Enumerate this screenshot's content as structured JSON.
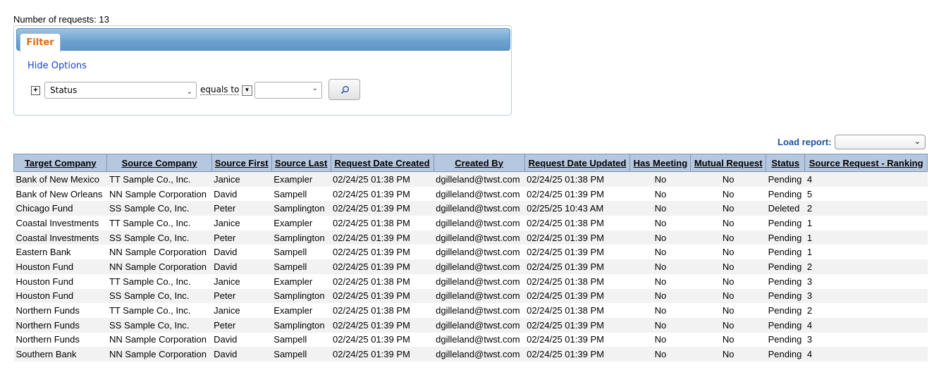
{
  "summary": {
    "label": "Number of requests: 13"
  },
  "filter": {
    "tab_label": "Filter",
    "hide_options_label": "Hide Options",
    "field_value": "Status",
    "operator_label": "equals to",
    "value": ""
  },
  "report": {
    "load_label": "Load report:",
    "selected": ""
  },
  "table": {
    "headers": [
      "Target Company",
      "Source Company",
      "Source First",
      "Source Last",
      "Request Date Created",
      "Created By",
      "Request Date Updated",
      "Has Meeting",
      "Mutual Request",
      "Status",
      "Source Request - Ranking"
    ],
    "rows": [
      [
        "Bank of New Mexico",
        "TT Sample Co., Inc.",
        "Janice",
        "Exampler",
        "02/24/25 01:38 PM",
        "dgilleland@twst.com",
        "02/24/25 01:38 PM",
        "No",
        "No",
        "Pending",
        "4"
      ],
      [
        "Bank of New Orleans",
        "NN Sample Corporation",
        "David",
        "Sampell",
        "02/24/25 01:39 PM",
        "dgilleland@twst.com",
        "02/24/25 01:39 PM",
        "No",
        "No",
        "Pending",
        "5"
      ],
      [
        "Chicago Fund",
        "SS Sample Co, Inc.",
        "Peter",
        "Samplington",
        "02/24/25 01:39 PM",
        "dgilleland@twst.com",
        "02/25/25 10:43 AM",
        "No",
        "No",
        "Deleted",
        "2"
      ],
      [
        "Coastal Investments",
        "TT Sample Co., Inc.",
        "Janice",
        "Exampler",
        "02/24/25 01:38 PM",
        "dgilleland@twst.com",
        "02/24/25 01:38 PM",
        "No",
        "No",
        "Pending",
        "1"
      ],
      [
        "Coastal Investments",
        "SS Sample Co, Inc.",
        "Peter",
        "Samplington",
        "02/24/25 01:39 PM",
        "dgilleland@twst.com",
        "02/24/25 01:39 PM",
        "No",
        "No",
        "Pending",
        "1"
      ],
      [
        "Eastern Bank",
        "NN Sample Corporation",
        "David",
        "Sampell",
        "02/24/25 01:39 PM",
        "dgilleland@twst.com",
        "02/24/25 01:39 PM",
        "No",
        "No",
        "Pending",
        "1"
      ],
      [
        "Houston Fund",
        "NN Sample Corporation",
        "David",
        "Sampell",
        "02/24/25 01:39 PM",
        "dgilleland@twst.com",
        "02/24/25 01:39 PM",
        "No",
        "No",
        "Pending",
        "2"
      ],
      [
        "Houston Fund",
        "TT Sample Co., Inc.",
        "Janice",
        "Exampler",
        "02/24/25 01:38 PM",
        "dgilleland@twst.com",
        "02/24/25 01:38 PM",
        "No",
        "No",
        "Pending",
        "3"
      ],
      [
        "Houston Fund",
        "SS Sample Co, Inc.",
        "Peter",
        "Samplington",
        "02/24/25 01:39 PM",
        "dgilleland@twst.com",
        "02/24/25 01:39 PM",
        "No",
        "No",
        "Pending",
        "3"
      ],
      [
        "Northern Funds",
        "TT Sample Co., Inc.",
        "Janice",
        "Exampler",
        "02/24/25 01:38 PM",
        "dgilleland@twst.com",
        "02/24/25 01:38 PM",
        "No",
        "No",
        "Pending",
        "2"
      ],
      [
        "Northern Funds",
        "SS Sample Co, Inc.",
        "Peter",
        "Samplington",
        "02/24/25 01:39 PM",
        "dgilleland@twst.com",
        "02/24/25 01:39 PM",
        "No",
        "No",
        "Pending",
        "4"
      ],
      [
        "Northern Funds",
        "NN Sample Corporation",
        "David",
        "Sampell",
        "02/24/25 01:39 PM",
        "dgilleland@twst.com",
        "02/24/25 01:39 PM",
        "No",
        "No",
        "Pending",
        "3"
      ],
      [
        "Southern Bank",
        "NN Sample Corporation",
        "David",
        "Sampell",
        "02/24/25 01:39 PM",
        "dgilleland@twst.com",
        "02/24/25 01:39 PM",
        "No",
        "No",
        "Pending",
        "4"
      ]
    ]
  }
}
